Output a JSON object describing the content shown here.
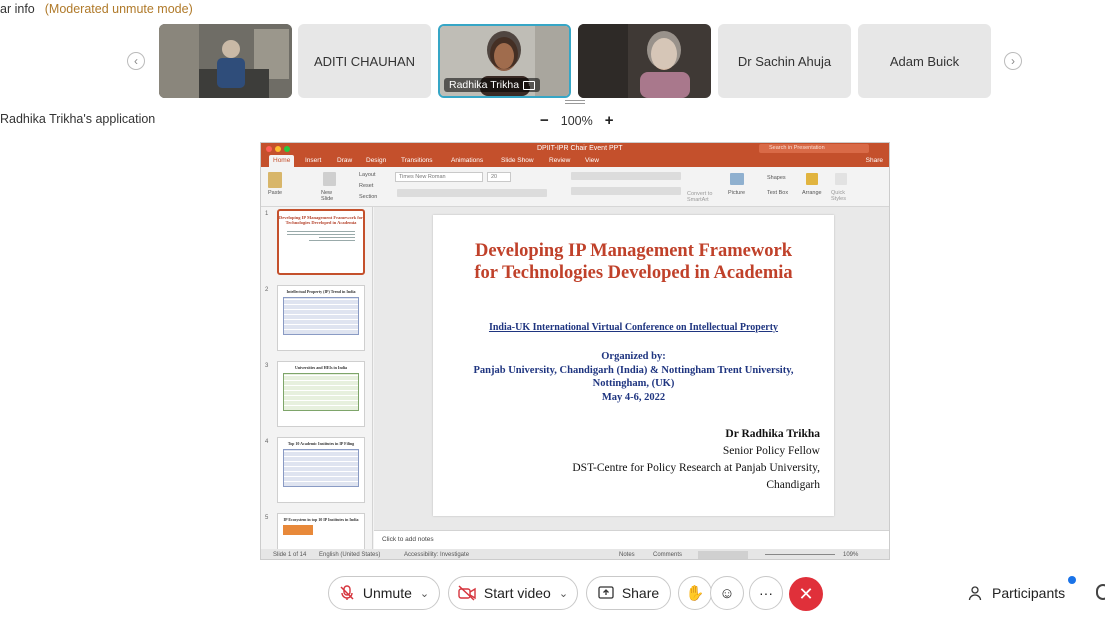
{
  "header": {
    "info_label": "ar info",
    "mode_label": "(Moderated unmute mode)"
  },
  "filmstrip": {
    "tiles": [
      {
        "kind": "video",
        "label": ""
      },
      {
        "kind": "name",
        "label": "ADITI CHAUHAN"
      },
      {
        "kind": "video",
        "label": "Radhika Trikha",
        "active": true
      },
      {
        "kind": "video",
        "label": ""
      },
      {
        "kind": "name",
        "label": "Dr Sachin Ahuja"
      },
      {
        "kind": "name",
        "label": "Adam Buick"
      }
    ],
    "prev_icon": "chevron-left-icon",
    "next_icon": "chevron-right-icon"
  },
  "share": {
    "app_label": "Radhika Trikha's application",
    "zoom_out": "−",
    "zoom_value": "100%",
    "zoom_in": "+"
  },
  "ppt": {
    "window_title": "DPIIT-IPR Chair Event PPT",
    "search_placeholder": "Search in Presentation",
    "share_label": "Share",
    "tabs": [
      "Home",
      "Insert",
      "Draw",
      "Design",
      "Transitions",
      "Animations",
      "Slide Show",
      "Review",
      "View"
    ],
    "ribbon": {
      "paste": "Paste",
      "new_slide": "New Slide",
      "layout": "Layout",
      "reset": "Reset",
      "section": "Section",
      "font_name": "Times New Roman",
      "font_size": "20",
      "convert": "Convert to SmartArt",
      "picture": "Picture",
      "shapes": "Shapes",
      "text_box": "Text Box",
      "arrange": "Arrange",
      "quick_styles": "Quick Styles"
    },
    "thumbnails": [
      {
        "num": "1",
        "title": "Developing IP Management Framework for Technologies Developed in Academia"
      },
      {
        "num": "2",
        "title": "Intellectual Property (IP) Trend in India"
      },
      {
        "num": "3",
        "title": "Universities and HEIs in India"
      },
      {
        "num": "4",
        "title": "Top 10 Academic Institutes in IP Filing"
      },
      {
        "num": "5",
        "title": "IP Ecosystem in top 10 IP Institutes in India"
      }
    ],
    "slide": {
      "title_line1": "Developing IP Management Framework",
      "title_line2": "for Technologies Developed in Academia",
      "conference": "India-UK International Virtual Conference on Intellectual Property",
      "organized_by": "Organized by:",
      "org_line1": "Panjab University, Chandigarh (India) & Nottingham Trent University,",
      "org_line2": "Nottingham, (UK)",
      "dates": "May 4-6, 2022",
      "author_name": "Dr Radhika Trikha",
      "author_role": "Senior Policy Fellow",
      "author_org_line1": "DST-Centre for Policy Research at Panjab University,",
      "author_org_line2": "Chandigarh"
    },
    "notes_placeholder": "Click to add notes",
    "status": {
      "slide_count": "Slide 1 of 14",
      "language": "English (United States)",
      "accessibility": "Accessibility: Investigate",
      "notes": "Notes",
      "comments": "Comments",
      "zoom": "109%"
    }
  },
  "controls": {
    "unmute": "Unmute",
    "start_video": "Start video",
    "share": "Share",
    "more": "···",
    "participants": "Participants"
  },
  "colors": {
    "ppt_accent": "#c4502c",
    "active_tile_border": "#36a6c6",
    "end_call": "#e0303a",
    "slide_title": "#c0412a",
    "slide_blue": "#1f3580"
  }
}
